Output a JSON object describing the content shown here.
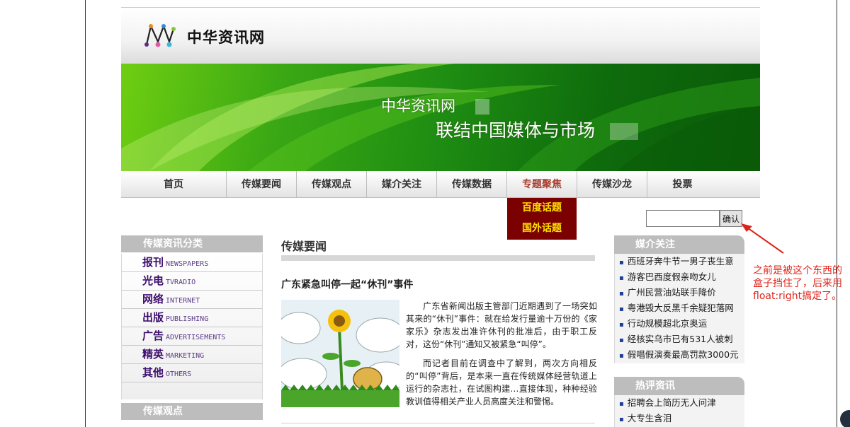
{
  "header": {
    "site_name": "中华资讯网",
    "logo_icon": "network-m-logo-icon"
  },
  "banner": {
    "line1": "中华资讯网",
    "line2": "联结中国媒体与市场"
  },
  "nav": {
    "items": [
      {
        "label": "首页"
      },
      {
        "label": "传媒要闻"
      },
      {
        "label": "传媒观点"
      },
      {
        "label": "媒介关注"
      },
      {
        "label": "传媒数据"
      },
      {
        "label": "专题聚焦"
      },
      {
        "label": "传媒沙龙"
      },
      {
        "label": "投票"
      }
    ],
    "active_index": 5,
    "dropdown": [
      {
        "label": "百度话题"
      },
      {
        "label": "国外话题"
      }
    ]
  },
  "search": {
    "value": "",
    "button_label": "确认"
  },
  "left_sidebar": {
    "title": "传媒资讯分类",
    "categories": [
      {
        "cn": "报刊",
        "en": "NEWSPAPERS"
      },
      {
        "cn": "光电",
        "en": "TVRADIO"
      },
      {
        "cn": "网络",
        "en": "INTERNET"
      },
      {
        "cn": "出版",
        "en": "PUBLISHING"
      },
      {
        "cn": "广告",
        "en": "ADVERTISEMENTS"
      },
      {
        "cn": "精英",
        "en": "MARKETING"
      },
      {
        "cn": "其他",
        "en": "OTHERS"
      }
    ],
    "second_title": "传媒观点"
  },
  "main": {
    "section_title": "传媒要闻",
    "article": {
      "title": "广东紧急叫停一起“休刊”事件",
      "image_icon": "sunflower-cartoon-image",
      "paragraphs": [
        "广东省新闻出版主管部门近期遇到了一场突如其来的“休刊”事件：就在给发行量逾十万份的《家家乐》杂志发出准许休刊的批准后，由于职工反对，这份“休刊”通知又被紧急“叫停”。",
        "而记者目前在调查中了解到，两次方向相反的“叫停”背后，是本来一直在传统媒体经营轨道上运行的杂志社，在试图构建…直接体现，种种经验教训值得相关产业人员高度关注和警惕。"
      ]
    }
  },
  "right_sidebar": {
    "sections": [
      {
        "title": "媒介关注",
        "items": [
          "西班牙奔牛节一男子丧生意",
          "游客巴西度假亲吻女儿",
          "广州民营油站联手降价",
          "粤港毁大反黑千余疑犯落网",
          "行动规模超北京奥运",
          "经核实乌市已有531人被刺",
          "假唱假演奏最高罚款3000元"
        ]
      },
      {
        "title": "热评资讯",
        "items": [
          "招聘会上简历无人问津",
          "大专生含泪"
        ]
      }
    ]
  },
  "annotation": {
    "text": "之前是被这个东西的盒子挡住了，后来用float:right搞定了。",
    "color": "#e0231a"
  },
  "colors": {
    "nav_dropdown_bg": "#7b0000",
    "dropdown_text": "#ffe000",
    "sidebar_head": "#bdbdbd",
    "category_text": "#3d0f6e"
  }
}
